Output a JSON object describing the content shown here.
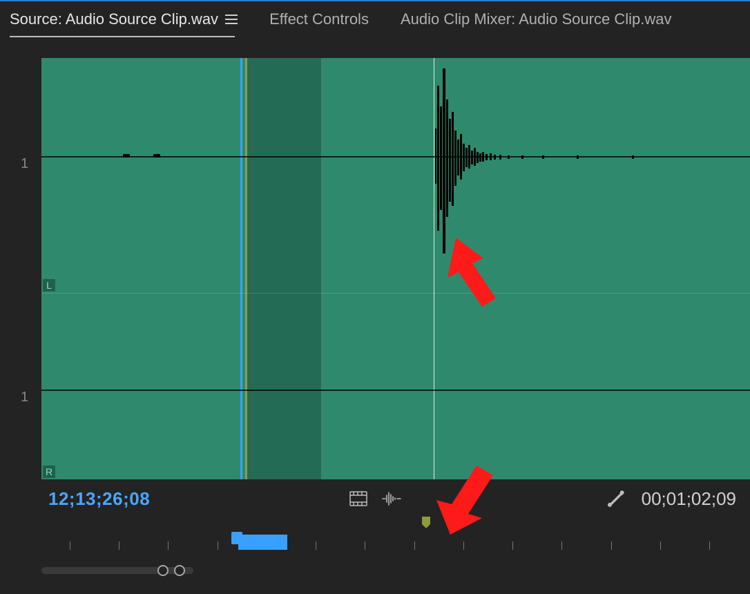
{
  "tabs": {
    "source": {
      "label": "Source: Audio Source Clip.wav"
    },
    "effects": {
      "label": "Effect Controls"
    },
    "mixer": {
      "label": "Audio Clip Mixer: Audio Source Clip.wav"
    }
  },
  "channels": {
    "top_scale": "1",
    "bottom_scale": "1",
    "left_label": "L",
    "right_label": "R"
  },
  "timecode": {
    "current": "12;13;26;08",
    "duration": "00;01;02;09"
  },
  "icons": {
    "hamburger": "menu",
    "video_frame": "drag-video",
    "audio_wave": "drag-audio",
    "wrench": "settings"
  },
  "marker": {
    "position_pct": 54
  },
  "zoom": {
    "start_pct": 28,
    "end_pct": 35,
    "handle_pct": 27
  },
  "annotations": {
    "arrow1": "pointer-to-transient",
    "arrow2": "pointer-to-marker"
  }
}
